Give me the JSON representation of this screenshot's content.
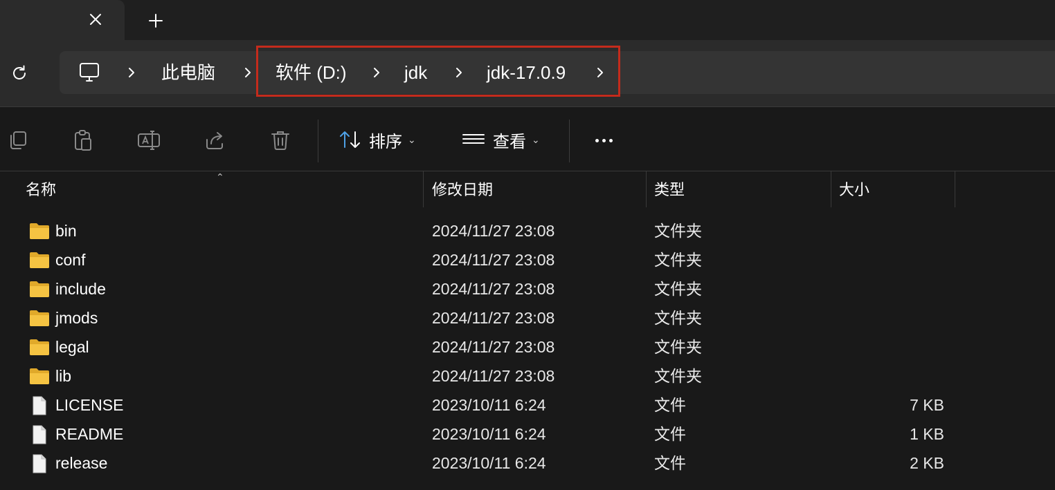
{
  "tabs": {
    "close_icon": "close-icon",
    "new_tab_icon": "plus-icon"
  },
  "address": {
    "refresh_icon": "refresh-icon",
    "pc_icon": "computer-icon",
    "crumbs": [
      {
        "label": "此电脑"
      },
      {
        "label": "软件 (D:)"
      },
      {
        "label": "jdk"
      },
      {
        "label": "jdk-17.0.9"
      }
    ],
    "highlight_color": "#c42b1c"
  },
  "toolbar": {
    "icons": [
      "copy-icon",
      "paste-icon",
      "rename-icon",
      "share-icon",
      "delete-icon"
    ],
    "sort_label": "排序",
    "view_label": "查看",
    "more_icon": "more-icon"
  },
  "columns": {
    "name": "名称",
    "date": "修改日期",
    "type": "类型",
    "size": "大小"
  },
  "files": [
    {
      "name": "bin",
      "date": "2024/11/27 23:08",
      "type": "文件夹",
      "size": "",
      "kind": "folder"
    },
    {
      "name": "conf",
      "date": "2024/11/27 23:08",
      "type": "文件夹",
      "size": "",
      "kind": "folder"
    },
    {
      "name": "include",
      "date": "2024/11/27 23:08",
      "type": "文件夹",
      "size": "",
      "kind": "folder"
    },
    {
      "name": "jmods",
      "date": "2024/11/27 23:08",
      "type": "文件夹",
      "size": "",
      "kind": "folder"
    },
    {
      "name": "legal",
      "date": "2024/11/27 23:08",
      "type": "文件夹",
      "size": "",
      "kind": "folder"
    },
    {
      "name": "lib",
      "date": "2024/11/27 23:08",
      "type": "文件夹",
      "size": "",
      "kind": "folder"
    },
    {
      "name": "LICENSE",
      "date": "2023/10/11 6:24",
      "type": "文件",
      "size": "7 KB",
      "kind": "file"
    },
    {
      "name": "README",
      "date": "2023/10/11 6:24",
      "type": "文件",
      "size": "1 KB",
      "kind": "file"
    },
    {
      "name": "release",
      "date": "2023/10/11 6:24",
      "type": "文件",
      "size": "2 KB",
      "kind": "file"
    }
  ],
  "colors": {
    "folder": "#f5c342",
    "folder_dark": "#e0a92a",
    "file": "#f2f2f2"
  }
}
